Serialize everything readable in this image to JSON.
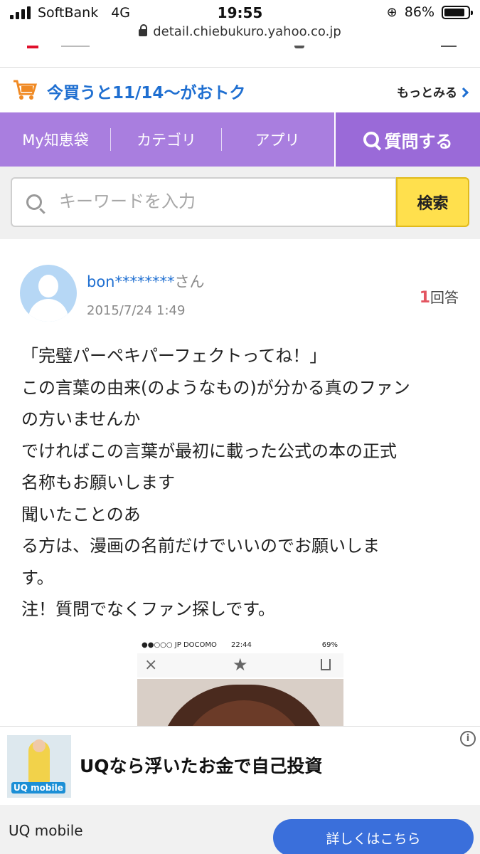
{
  "status_bar": {
    "carrier": "SoftBank",
    "network": "4G",
    "time": "19:55",
    "battery": "86%",
    "battery_level": 0.86
  },
  "url_bar": {
    "url": "detail.chiebukuro.yahoo.co.jp"
  },
  "promo": {
    "text": "今買うと11/14〜がおトク",
    "more_label": "もっとみる",
    "icon": "cart-icon",
    "accent": "#1f6fd1"
  },
  "nav": {
    "items": [
      {
        "label": "My知恵袋"
      },
      {
        "label": "カテゴリ"
      },
      {
        "label": "アプリ"
      }
    ],
    "ask_label": "質問する",
    "bg_color": "#a97edf"
  },
  "search": {
    "placeholder": "キーワードを入力",
    "value": "",
    "button_label": "検索",
    "button_color": "#ffe04d"
  },
  "question": {
    "user_name": "bon********",
    "user_suffix": "さん",
    "date": "2015/7/24 1:49",
    "answer_count": "1",
    "answer_label": "回答",
    "body_lines": [
      "「完璧パーペキパーフェクトってね！」",
      "この言葉の由来(のようなもの)が分かる真のファン",
      "の方いませんか",
      "でければこの言葉が最初に載った公式の本の正式",
      "名称もお願いします",
      "聞いたことのあ",
      "る方は、漫画の名前だけでいいのでお願いしま",
      "す。",
      "注！質問でなくファン探しです。"
    ]
  },
  "embedded_image": {
    "carrier": "●●○○○ JP DOCOMO",
    "time": "22:44",
    "battery": "69%"
  },
  "ad": {
    "headline": "UQなら浮いたお金で自己投資",
    "brand": "UQ mobile",
    "thumb_logo": "UQ mobile",
    "cta_label": "詳しくはこちら",
    "cta_color": "#3a6fdb"
  }
}
